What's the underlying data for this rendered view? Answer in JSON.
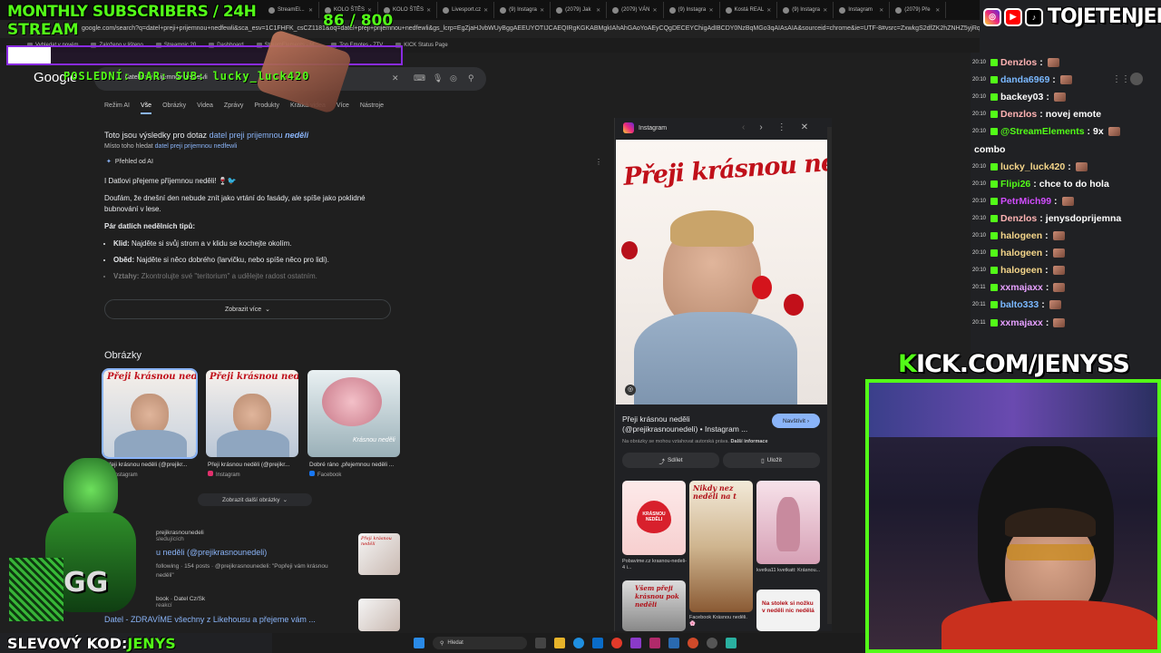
{
  "overlay": {
    "subs_title": "MONTHLY SUBSCRIBERS / 24H",
    "subs_title2": "STREAM",
    "sub_count": "86 / 800",
    "sub_progress": 0.1075,
    "last_sub": "POSLEDNÍ: DAR: SUB: lucky_luck420",
    "social_name": "TOJETENJENYS",
    "kick_prefix": "K",
    "kick_rest": "ICK.COM/JENYSS",
    "promo_prefix": "SLEVOVÝ KOD:",
    "promo_code": "JENYS"
  },
  "browser": {
    "tabs": [
      "StreamEl...",
      "KOLO ŠTĚS",
      "KOLO ŠTĚS",
      "Livesport.cz",
      "(9) Instagra",
      "(2079) Jak",
      "(2079) VÁN",
      "(9) Instagra",
      "Kostá REAL",
      "(9) Instagra",
      "Instagram",
      "(2079) Pře"
    ],
    "url": "google.com/search?q=datel+preji+prijemnou+nedfewli&sca_esv=1C1FHFK_csCZ1181&oq=datel+preji+prijemnou+nedfewli&gs_lcrp=EgZjaHJvbWUyBggAEEUYOTIJCAEQIRgKGKABMgkIAhAhGAoYoAEyCQgDECEYChigAdIBCDY0NzBqMGo3qAIAsAIA&sourceid=chrome&ie=UTF-8#vsrc=ZxwkgS2dfZK2hZNHZ5yjRqTTg",
    "bookmarks": [
      "Vyhledat v novém",
      "Založeno v lišteno",
      "Streamnic 20",
      "Dashboard",
      "StreamElements - M...",
      "Top Emotes - 7TV",
      "KICK Status Page"
    ]
  },
  "google": {
    "logo": "Google",
    "query": "datel preji prijemnou nedfewli",
    "nav": [
      "Režim AI",
      "Vše",
      "Obrázky",
      "Videa",
      "Zprávy",
      "Produkty",
      "Krátká videa",
      "Více",
      "Nástroje"
    ],
    "note_prefix": "Toto jsou výsledky pro dotaz ",
    "note_query": "datel preji prijemnou ",
    "note_query_bold": "neděli",
    "note2_prefix": "Místo toho hledat ",
    "note2_link": "datel preji prijemnou nedfewli",
    "ai_label": "Přehled od AI",
    "ai_p1": "I Datlovi přejeme příjemnou neděli! 🍷🐦",
    "ai_p2": "Doufám, že dnešní den nebude znít jako vrtání do fasády, ale spíše jako poklidné bubnování v lese.",
    "ai_p3": "Pár datlích nedělních tipů:",
    "tips": [
      {
        "k": "Klid:",
        "v": " Najděte si svůj strom a v klidu se kochejte okolím."
      },
      {
        "k": "Oběd:",
        "v": " Najděte si něco dobrého (larvičku, nebo spíše něco pro lidi)."
      },
      {
        "k": "Vztahy:",
        "v": " Zkontrolujte své \"teritorium\" a udělejte radost ostatním."
      }
    ],
    "show_more": "Zobrazit více",
    "images_heading": "Obrázky",
    "thumbs": [
      {
        "cap": "Přeji krásnou neděli (@prejikr...",
        "src": "Instagram"
      },
      {
        "cap": "Přeji krásnou neděli (@prejikr...",
        "src": "Instagram"
      },
      {
        "cap": "Dobré ráno ,přejemnou neděli ...",
        "src": "Facebook"
      }
    ],
    "more_images": "Zobrazit další obrázky",
    "res2_user": "prejikrasnounedeli",
    "res2_user2": "sledujících",
    "res2_title": "u neděli (@prejikrasnounedeli)",
    "res2_snip": "following · 154 posts · @prejikrasnounedeli: \"Popřeji vám krásnou neděli\"",
    "res3_src": "book · Datel Cz/Sk",
    "res3_src2": "reakcí",
    "res3_title": "Datel - ZDRAVÍME všechny z Likehousu a přejeme vám ...",
    "thumb_text_1": "Přeji krásnou neděli",
    "thumb_text_3": "Krásnou neděli"
  },
  "panel": {
    "source": "Instagram",
    "preview_text": "Přeji krásnou neděli",
    "title": "Přeji krásnou neděli (@prejikrasnounedeli) • Instagram ...",
    "visit": "Navštívit",
    "copyright": "Na obrázky se mohou vztahovat autorská práva.",
    "copyright_link": "Další informace",
    "share": "Sdílet",
    "save": "Uložit",
    "related": [
      {
        "cap": "Pobavime.cz krasnou-nedeli-4 i...",
        "src": "Pobavime.cz",
        "text": "KRÁSNOU NEDĚLI"
      },
      {
        "cap": "Facebook Krásnou neděli. 🌸",
        "src": "Facebook",
        "text": "Nikdy nez neděli na t"
      },
      {
        "cap": "kvetka11 kvetkatt: Krásnou...",
        "src": "kvetka11",
        "text": ""
      }
    ],
    "related_text_4": "Všem přeji krásnou pok neděli",
    "related_text_5": "Na stolek si nožku v neděli nic nedělá"
  },
  "chat": [
    {
      "t": "20:10",
      "u": "Denzlos",
      "c": "#ffb3b3",
      "m": ""
    },
    {
      "t": "20:10",
      "u": "danda6969",
      "c": "#7ab8ff",
      "m": ""
    },
    {
      "t": "20:10",
      "u": "backey03",
      "c": "#ffffff",
      "m": ""
    },
    {
      "t": "20:10",
      "u": "Denzlos",
      "c": "#ffb3b3",
      "m": "novej emote"
    },
    {
      "t": "20:10",
      "u": "@StreamElements",
      "c": "#53fc18",
      "m": "9x"
    },
    {
      "t": "",
      "u": "",
      "c": "#ffffff",
      "m": "combo"
    },
    {
      "t": "20:10",
      "u": "lucky_luck420",
      "c": "#f5d68a",
      "m": ""
    },
    {
      "t": "20:10",
      "u": "Flipi26",
      "c": "#53fc18",
      "m": "chce to do hola"
    },
    {
      "t": "20:10",
      "u": "PetrMich99",
      "c": "#d24dff",
      "m": ""
    },
    {
      "t": "20:10",
      "u": "Denzlos",
      "c": "#ffb3b3",
      "m": "jenysdoprijemna"
    },
    {
      "t": "20:10",
      "u": "halogeen",
      "c": "#f5d68a",
      "m": ""
    },
    {
      "t": "20:10",
      "u": "halogeen",
      "c": "#f5d68a",
      "m": ""
    },
    {
      "t": "20:10",
      "u": "halogeen",
      "c": "#f5d68a",
      "m": ""
    },
    {
      "t": "20:11",
      "u": "xxmajaxx",
      "c": "#e6a0ff",
      "m": ""
    },
    {
      "t": "20:11",
      "u": "balto333",
      "c": "#7ab8ff",
      "m": ""
    },
    {
      "t": "20:11",
      "u": "xxmajaxx",
      "c": "#e6a0ff",
      "m": ""
    }
  ],
  "taskbar": {
    "search": "Hledat"
  }
}
